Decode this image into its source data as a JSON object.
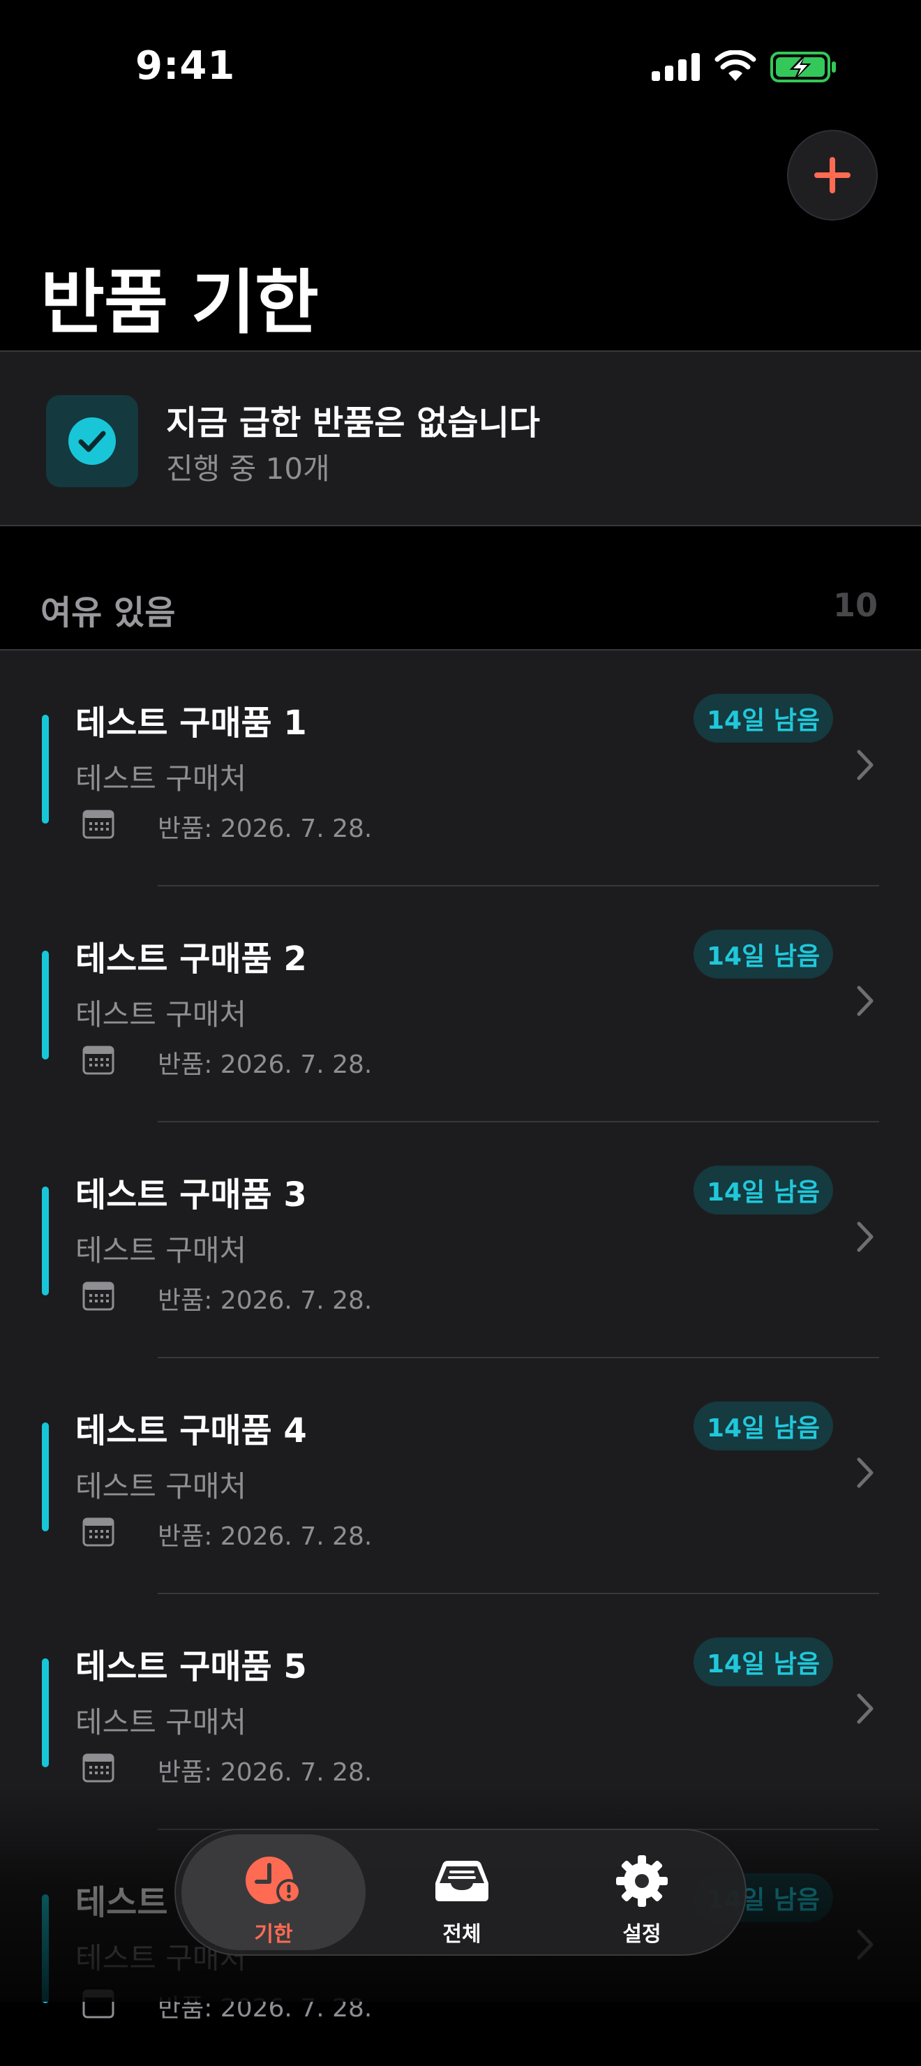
{
  "status_bar": {
    "time": "9:41"
  },
  "header": {
    "title": "반품 기한",
    "add_icon": "plus-icon"
  },
  "summary": {
    "title": "지금 급한 반품은 없습니다",
    "subtitle": "진행 중 10개",
    "icon": "checkmark-icon"
  },
  "section": {
    "title": "여유 있음",
    "count": "10"
  },
  "items": [
    {
      "title": "테스트 구매품 1",
      "store": "테스트 구매처",
      "date": "반품: 2026. 7. 28.",
      "badge": "14일 남음"
    },
    {
      "title": "테스트 구매품 2",
      "store": "테스트 구매처",
      "date": "반품: 2026. 7. 28.",
      "badge": "14일 남음"
    },
    {
      "title": "테스트 구매품 3",
      "store": "테스트 구매처",
      "date": "반품: 2026. 7. 28.",
      "badge": "14일 남음"
    },
    {
      "title": "테스트 구매품 4",
      "store": "테스트 구매처",
      "date": "반품: 2026. 7. 28.",
      "badge": "14일 남음"
    },
    {
      "title": "테스트 구매품 5",
      "store": "테스트 구매처",
      "date": "반품: 2026. 7. 28.",
      "badge": "14일 남음"
    },
    {
      "title": "테스트 구매품 6",
      "store": "테스트 구매처",
      "date": "반품: 2026. 7. 28.",
      "badge": "14일 남음"
    }
  ],
  "tabs": [
    {
      "label": "기한",
      "icon": "clock-alert-icon",
      "active": true
    },
    {
      "label": "전체",
      "icon": "tray-icon",
      "active": false
    },
    {
      "label": "설정",
      "icon": "gear-icon",
      "active": false
    }
  ],
  "colors": {
    "accent": "#18c6d8",
    "alert": "#ff6b52",
    "background": "#000000",
    "card": "#1c1c1e"
  }
}
